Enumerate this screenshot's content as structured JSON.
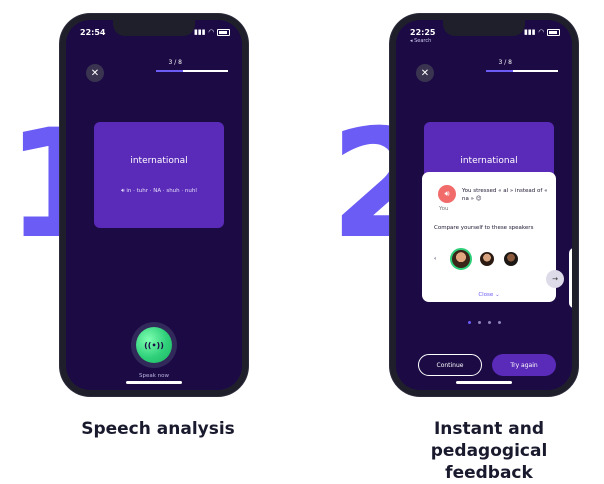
{
  "steps": [
    {
      "number": "1",
      "caption": "Speech analysis",
      "status_time": "22:54",
      "progress_label": "3 / 8",
      "progress_fraction": 0.375,
      "word": "international",
      "phonetic": "in · tuhr · NA · shuh · nuhl",
      "speak_label": "Speak now"
    },
    {
      "number": "2",
      "caption_line1": "Instant and pedagogical",
      "caption_line2": "feedback",
      "status_time": "22:25",
      "back_label": "◂ Search",
      "progress_label": "3 / 8",
      "progress_fraction": 0.375,
      "word": "international",
      "feedback_text": "You stressed « al » instead of « na » 😊",
      "you_label": "You",
      "compare_text": "Compare yourself to these speakers",
      "close_label": "Close",
      "continue_label": "Continue",
      "try_again_label": "Try again",
      "page_dots": 4,
      "active_dot": 0
    }
  ],
  "colors": {
    "accent": "#6b5cf5",
    "screen_bg": "#1c0a45",
    "card_bg": "#5a2ab8",
    "speak_green": "#2fcf7a",
    "alert_red": "#f26b6b"
  }
}
